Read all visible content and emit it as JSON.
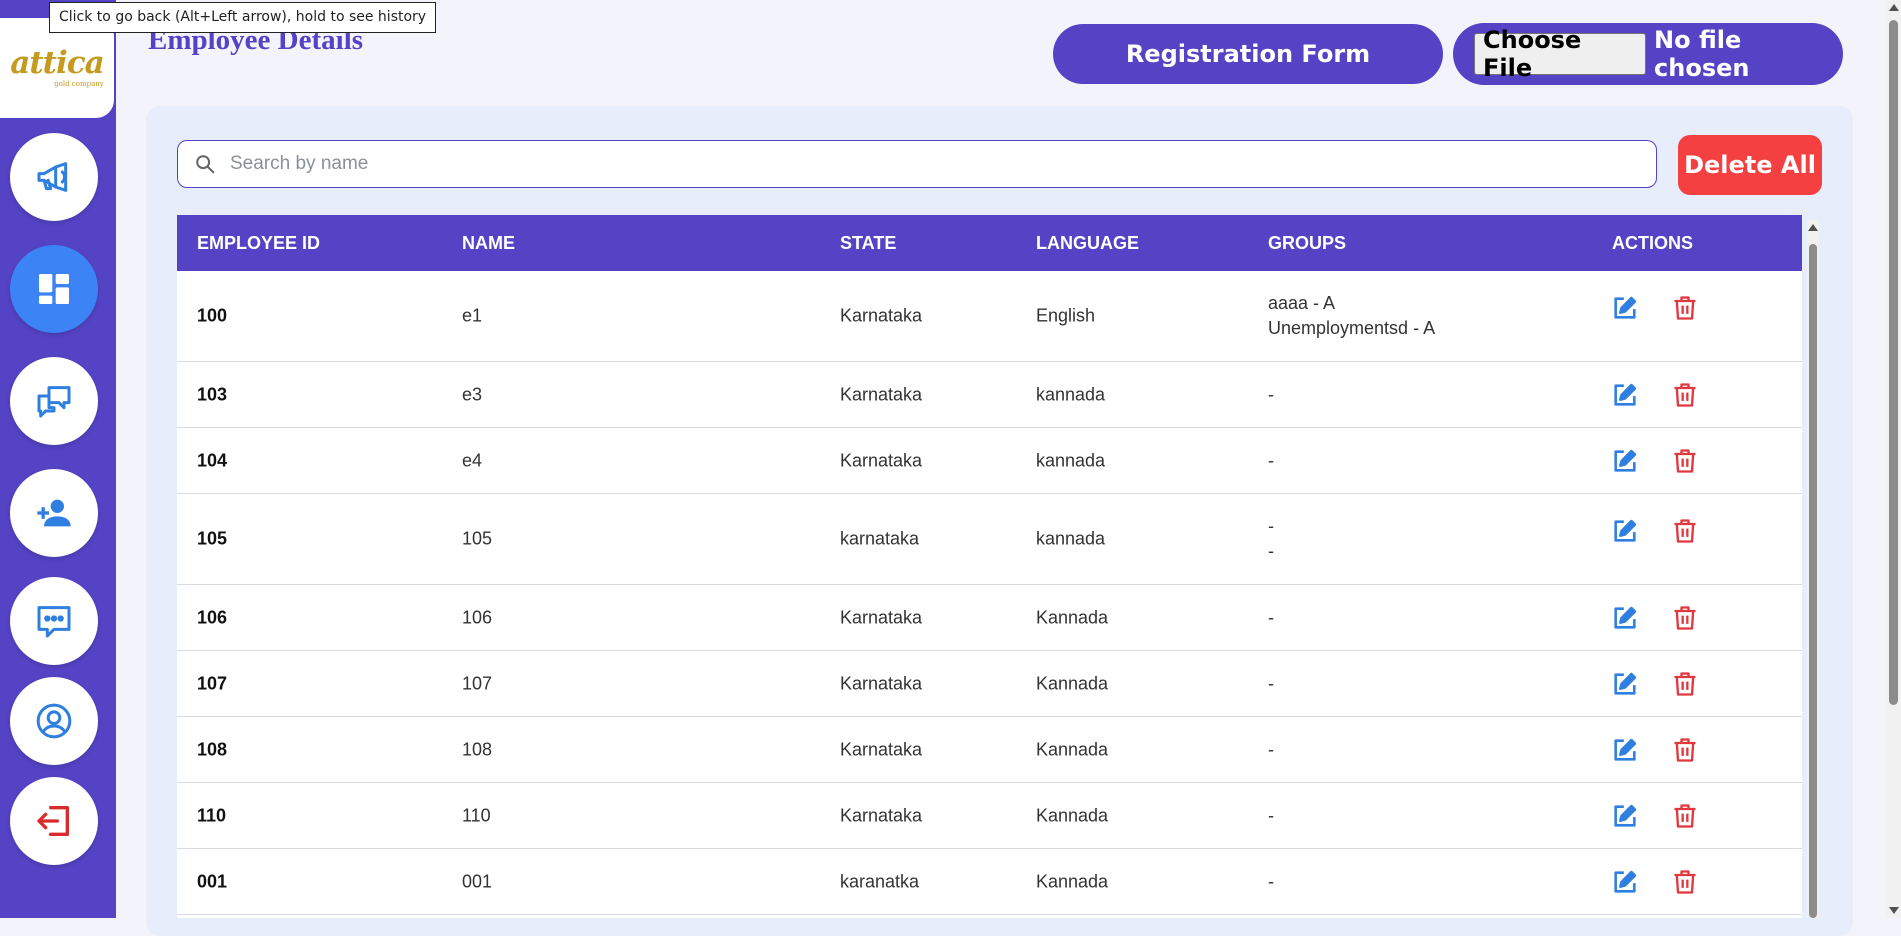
{
  "tooltip": "Click to go back (Alt+Left arrow), hold to see history",
  "logo": {
    "main": "attica",
    "sub": "gold company"
  },
  "page_title": "Employee Details",
  "header": {
    "registration_label": "Registration Form",
    "choose_file_label": "Choose File",
    "file_status": "No file chosen"
  },
  "search": {
    "placeholder": "Search by name",
    "value": ""
  },
  "delete_all_label": "Delete All",
  "table": {
    "columns": [
      "EMPLOYEE ID",
      "NAME",
      "STATE",
      "LANGUAGE",
      "GROUPS",
      "ACTIONS"
    ],
    "rows": [
      {
        "id": "100",
        "name": "e1",
        "state": "Karnataka",
        "language": "English",
        "groups": [
          "aaaa - A",
          "Unemploymentsd - A"
        ]
      },
      {
        "id": "103",
        "name": "e3",
        "state": "Karnataka",
        "language": "kannada",
        "groups": [
          "-"
        ]
      },
      {
        "id": "104",
        "name": "e4",
        "state": "Karnataka",
        "language": "kannada",
        "groups": [
          "-"
        ]
      },
      {
        "id": "105",
        "name": "105",
        "state": "karnataka",
        "language": "kannada",
        "groups": [
          "-",
          "-"
        ]
      },
      {
        "id": "106",
        "name": "106",
        "state": "Karnataka",
        "language": "Kannada",
        "groups": [
          "-"
        ]
      },
      {
        "id": "107",
        "name": "107",
        "state": "Karnataka",
        "language": "Kannada",
        "groups": [
          "-"
        ]
      },
      {
        "id": "108",
        "name": "108",
        "state": "Karnataka",
        "language": "Kannada",
        "groups": [
          "-"
        ]
      },
      {
        "id": "110",
        "name": "110",
        "state": "Karnataka",
        "language": "Kannada",
        "groups": [
          "-"
        ]
      },
      {
        "id": "001",
        "name": "001",
        "state": "karanatka",
        "language": "Kannada",
        "groups": [
          "-"
        ]
      }
    ]
  },
  "sidebar_icons": [
    "megaphone-icon",
    "dashboard-icon",
    "chat-bubbles-icon",
    "add-user-icon",
    "message-icon",
    "user-circle-icon",
    "logout-icon"
  ],
  "colors": {
    "primary": "#5443c5",
    "active_nav": "#3c83f6",
    "danger": "#f44040",
    "edit_icon": "#2f7fe0",
    "delete_icon": "#e0383e"
  }
}
